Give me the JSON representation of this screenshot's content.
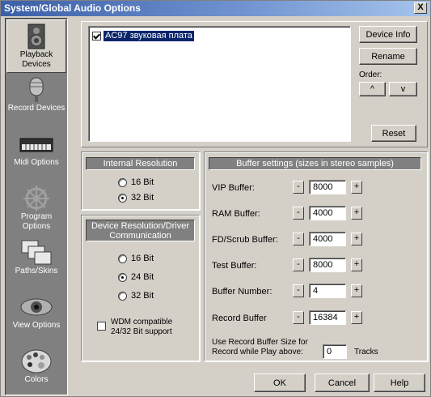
{
  "window": {
    "title": "System/Global Audio Options",
    "close_label": "X"
  },
  "sidebar": {
    "items": [
      {
        "label": "Playback Devices",
        "active": true
      },
      {
        "label": "Record Devices"
      },
      {
        "label": "Midi Options"
      },
      {
        "label": "Program Options"
      },
      {
        "label": "Paths/Skins"
      },
      {
        "label": "View Options"
      },
      {
        "label": "Colors"
      }
    ]
  },
  "devices": {
    "list": [
      {
        "name": "AC97 звуковая плата",
        "checked": true
      }
    ],
    "device_info_label": "Device Info",
    "rename_label": "Rename",
    "order_label": "Order:",
    "up_label": "^",
    "down_label": "v",
    "reset_label": "Reset"
  },
  "internal_resolution": {
    "title": "Internal Resolution",
    "options": [
      "16 Bit",
      "32 Bit"
    ],
    "selected": "32 Bit"
  },
  "device_resolution": {
    "title": "Device Resolution/Driver Communication",
    "options": [
      "16 Bit",
      "24 Bit",
      "32 Bit"
    ],
    "selected": "24 Bit",
    "wdm_label": "WDM compatible 24/32 Bit support",
    "wdm_checked": false
  },
  "buffers": {
    "title": "Buffer settings (sizes in stereo samples)",
    "rows": [
      {
        "label": "VIP Buffer:",
        "value": "8000"
      },
      {
        "label": "RAM Buffer:",
        "value": "4000"
      },
      {
        "label": "FD/Scrub Buffer:",
        "value": "4000"
      },
      {
        "label": "Test Buffer:",
        "value": "8000"
      },
      {
        "label": "Buffer Number:",
        "value": "4"
      },
      {
        "label": "Record Buffer",
        "value": "16384"
      }
    ],
    "minus_label": "-",
    "plus_label": "+",
    "record_size_label": "Use Record Buffer Size for Record while Play above:",
    "record_size_value": "0",
    "tracks_label": "Tracks"
  },
  "footer": {
    "ok_label": "OK",
    "cancel_label": "Cancel",
    "help_label": "Help"
  }
}
